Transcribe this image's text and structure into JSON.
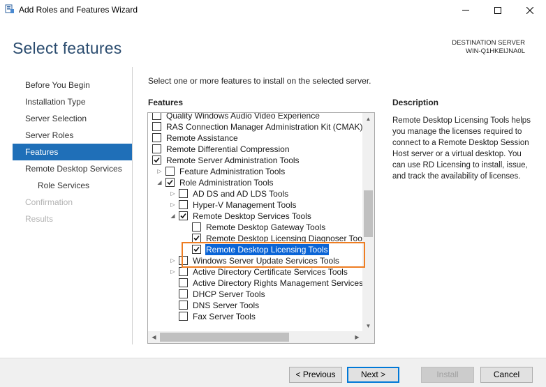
{
  "window": {
    "title": "Add Roles and Features Wizard"
  },
  "header": {
    "page_title": "Select features",
    "destination_label": "DESTINATION SERVER",
    "destination_server": "WIN-Q1HKEIJNA0L"
  },
  "nav": {
    "items": [
      {
        "label": "Before You Begin",
        "state": "normal"
      },
      {
        "label": "Installation Type",
        "state": "normal"
      },
      {
        "label": "Server Selection",
        "state": "normal"
      },
      {
        "label": "Server Roles",
        "state": "normal"
      },
      {
        "label": "Features",
        "state": "active"
      },
      {
        "label": "Remote Desktop Services",
        "state": "normal"
      },
      {
        "label": "Role Services",
        "state": "normal"
      },
      {
        "label": "Confirmation",
        "state": "disabled"
      },
      {
        "label": "Results",
        "state": "disabled"
      }
    ]
  },
  "main": {
    "instruction": "Select one or more features to install on the selected server.",
    "features_heading": "Features",
    "description_heading": "Description",
    "description_text": "Remote Desktop Licensing Tools helps you manage the licenses required to connect to a Remote Desktop Session Host server or a virtual desktop. You can use RD Licensing to install, issue, and track the availability of licenses."
  },
  "tree": {
    "rows": [
      {
        "label": "Quality Windows Audio Video Experience",
        "checked": false,
        "expander": "none"
      },
      {
        "label": "RAS Connection Manager Administration Kit (CMAK)",
        "checked": false,
        "expander": "none"
      },
      {
        "label": "Remote Assistance",
        "checked": false,
        "expander": "none"
      },
      {
        "label": "Remote Differential Compression",
        "checked": false,
        "expander": "none"
      },
      {
        "label": "Remote Server Administration Tools",
        "checked": true,
        "expander": "none"
      },
      {
        "label": "Feature Administration Tools",
        "checked": false,
        "expander": "collapsed"
      },
      {
        "label": "Role Administration Tools",
        "checked": true,
        "expander": "expanded"
      },
      {
        "label": "AD DS and AD LDS Tools",
        "checked": false,
        "expander": "collapsed"
      },
      {
        "label": "Hyper-V Management Tools",
        "checked": false,
        "expander": "collapsed"
      },
      {
        "label": "Remote Desktop Services Tools",
        "checked": true,
        "expander": "expanded"
      },
      {
        "label": "Remote Desktop Gateway Tools",
        "checked": false,
        "expander": "none"
      },
      {
        "label": "Remote Desktop Licensing Diagnoser Tools",
        "checked": true,
        "expander": "none"
      },
      {
        "label": "Remote Desktop Licensing Tools",
        "checked": true,
        "expander": "none",
        "selected": true
      },
      {
        "label": "Windows Server Update Services Tools",
        "checked": false,
        "expander": "collapsed"
      },
      {
        "label": "Active Directory Certificate Services Tools",
        "checked": false,
        "expander": "collapsed"
      },
      {
        "label": "Active Directory Rights Management Services",
        "checked": false,
        "expander": "none"
      },
      {
        "label": "DHCP Server Tools",
        "checked": false,
        "expander": "none"
      },
      {
        "label": "DNS Server Tools",
        "checked": false,
        "expander": "none"
      },
      {
        "label": "Fax Server Tools",
        "checked": false,
        "expander": "none"
      }
    ]
  },
  "footer": {
    "previous_label": "< Previous",
    "next_label": "Next >",
    "install_label": "Install",
    "cancel_label": "Cancel"
  },
  "colors": {
    "accent": "#1f6fb8",
    "selection": "#0a64d6",
    "highlight_box": "#ee7d22",
    "title": "#2b4c6f"
  }
}
